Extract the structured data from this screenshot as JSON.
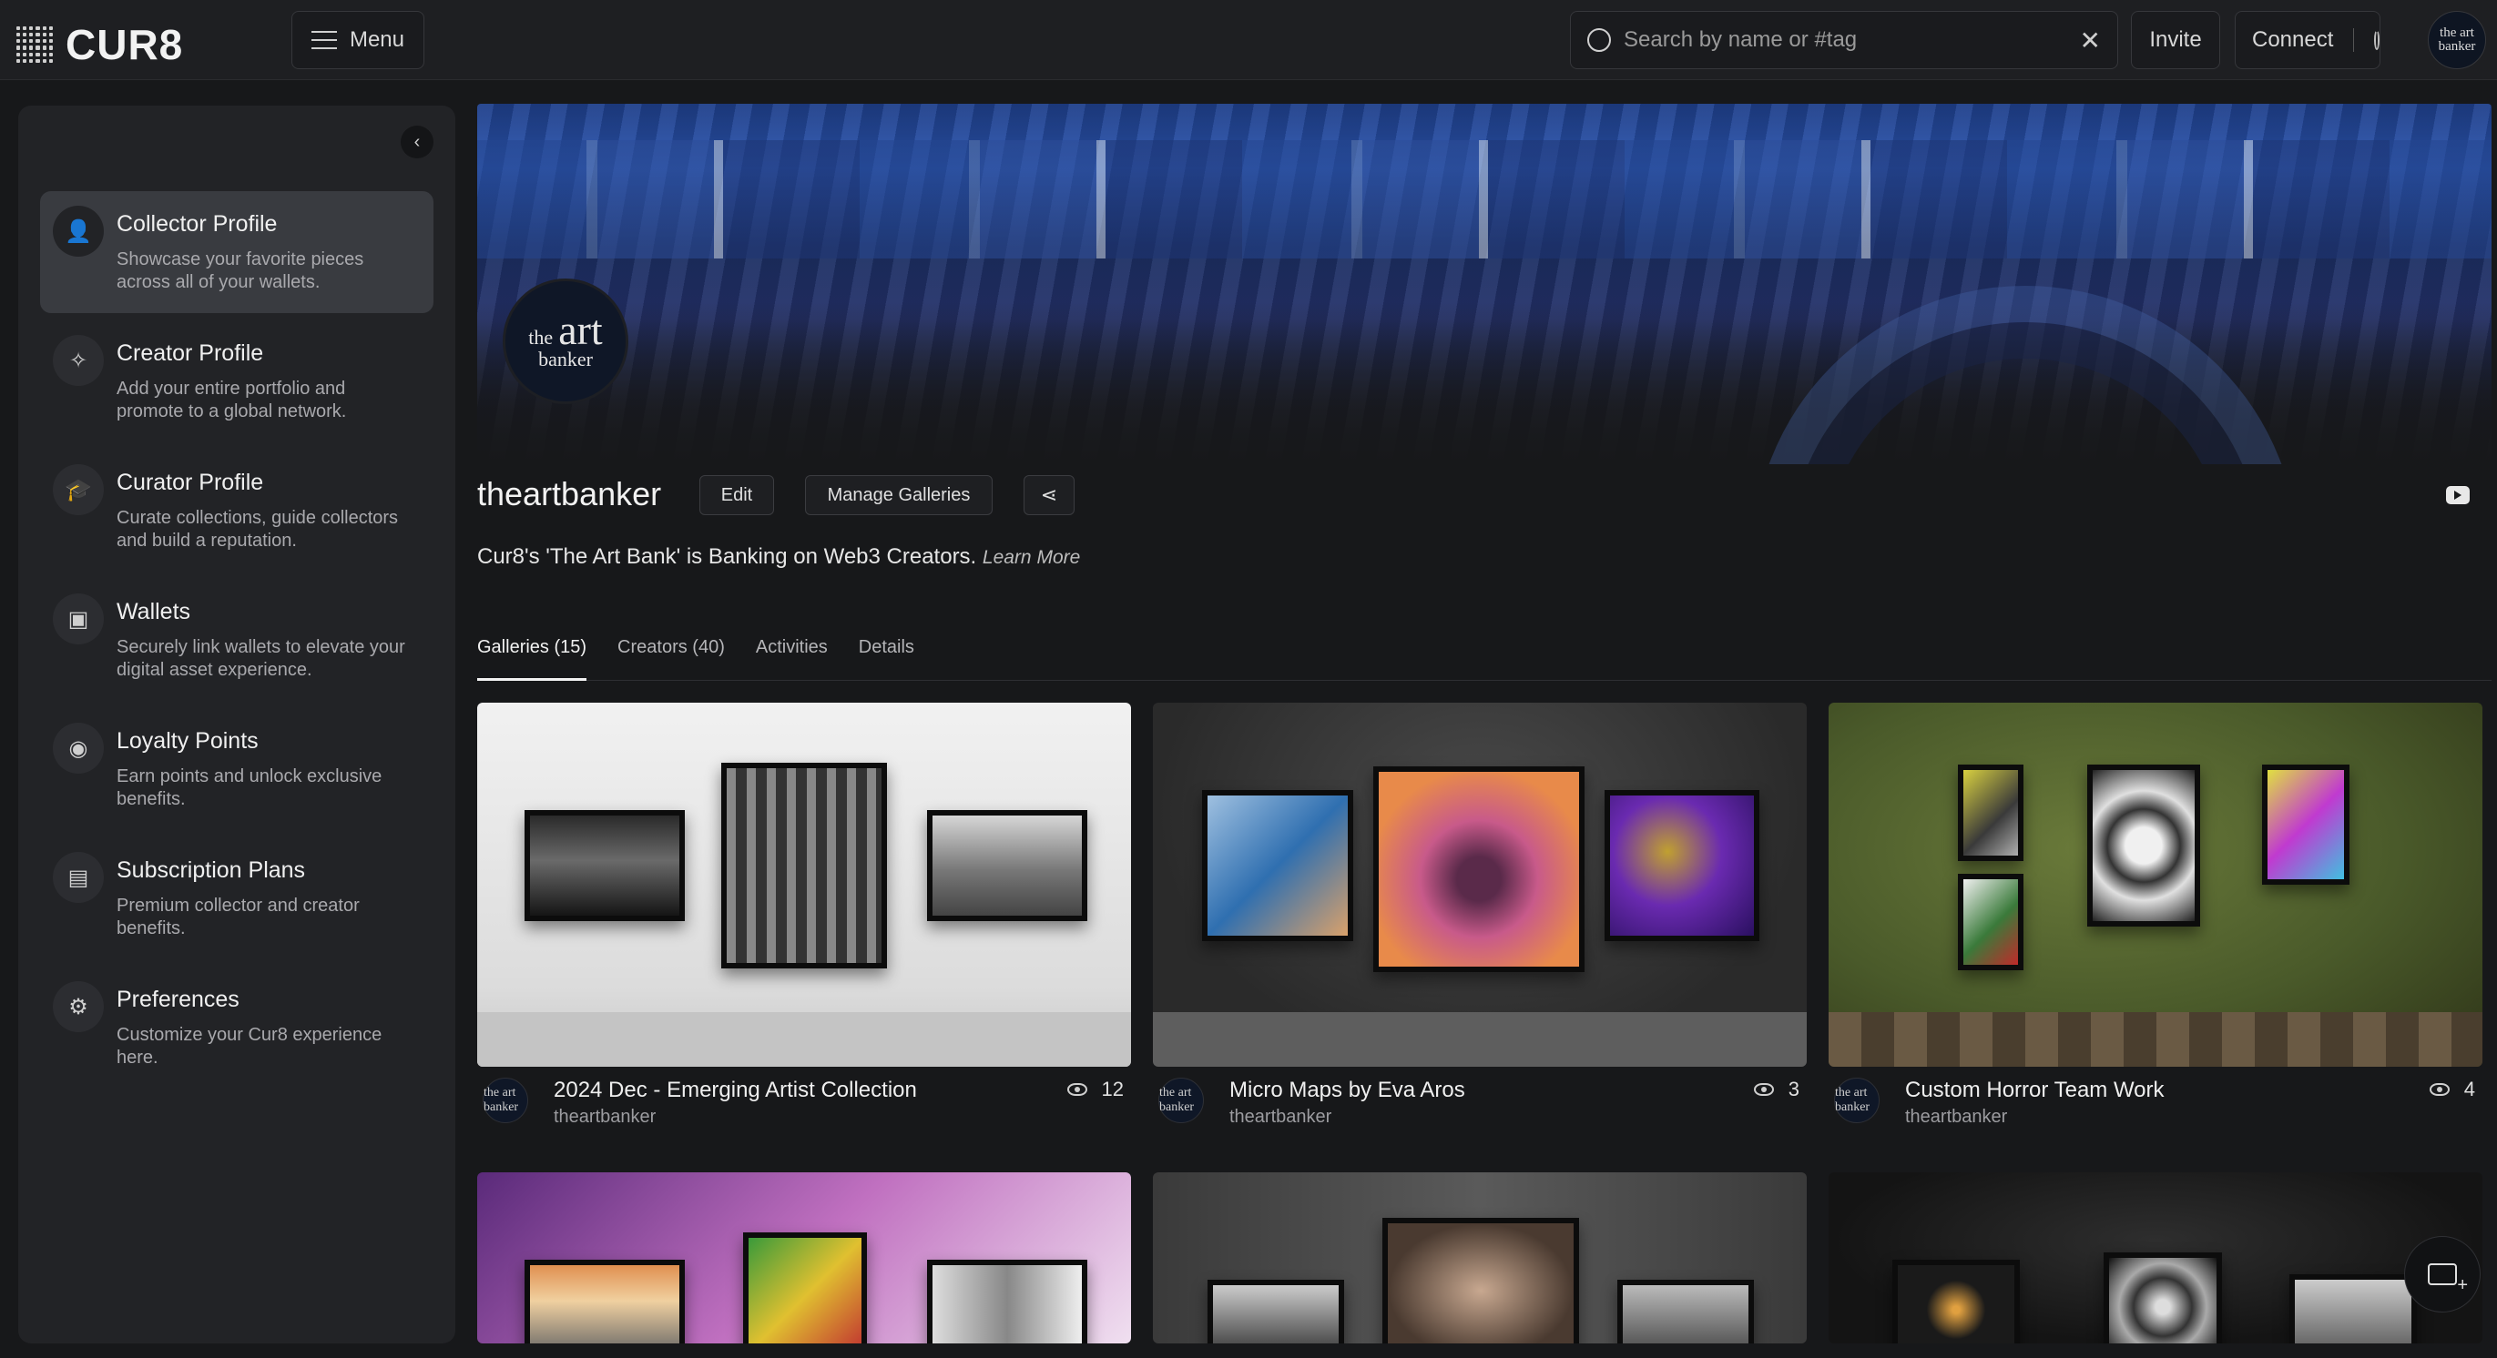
{
  "app": {
    "logo_text": "CUR8"
  },
  "header": {
    "menu_label": "Menu",
    "search_placeholder": "Search by name or #tag",
    "clear_glyph": "✕",
    "invite_label": "Invite",
    "connect_label": "Connect",
    "avatar_text": "the art banker"
  },
  "sidebar": {
    "collapse_glyph": "‹",
    "items": [
      {
        "title": "Collector Profile",
        "desc": "Showcase your favorite pieces across all of your wallets.",
        "icon": "person-icon",
        "glyph": "👤",
        "active": true
      },
      {
        "title": "Creator Profile",
        "desc": "Add your entire portfolio and promote to a global network.",
        "icon": "sparkle-icon",
        "glyph": "✧"
      },
      {
        "title": "Curator Profile",
        "desc": "Curate collections, guide collectors and build a reputation.",
        "icon": "graduation-cap-icon",
        "glyph": "🎓"
      },
      {
        "title": "Wallets",
        "desc": "Securely link wallets to elevate your digital asset experience.",
        "icon": "wallet-icon",
        "glyph": "▣"
      },
      {
        "title": "Loyalty Points",
        "desc": "Earn points and unlock exclusive benefits.",
        "icon": "loyalty-points-icon",
        "glyph": "◉"
      },
      {
        "title": "Subscription Plans",
        "desc": "Premium collector and creator benefits.",
        "icon": "subscription-icon",
        "glyph": "▤"
      },
      {
        "title": "Preferences",
        "desc": "Customize your Cur8 experience here.",
        "icon": "gear-icon",
        "glyph": "⚙"
      }
    ]
  },
  "profile": {
    "avatar": {
      "the": "the",
      "art": "art",
      "banker": "banker"
    },
    "name": "theartbanker",
    "edit_label": "Edit",
    "manage_label": "Manage Galleries",
    "share_glyph": "⋖",
    "bio": "Cur8's 'The Art Bank' is Banking on Web3 Creators.",
    "learn_more": "Learn More"
  },
  "tabs": [
    {
      "label": "Galleries (15)",
      "active": true
    },
    {
      "label": "Creators (40)"
    },
    {
      "label": "Activities"
    },
    {
      "label": "Details"
    }
  ],
  "galleries": [
    {
      "title": "2024 Dec - Emerging Artist Collection",
      "owner": "theartbanker",
      "views": "12"
    },
    {
      "title": "Micro Maps by Eva Aros",
      "owner": "theartbanker",
      "views": "3"
    },
    {
      "title": "Custom Horror Team Work",
      "owner": "theartbanker",
      "views": "4"
    }
  ],
  "card_avatar_text": "the art banker",
  "colors": {
    "background": "#17181a",
    "sidebar": "#222326",
    "active_item": "#393b40"
  }
}
